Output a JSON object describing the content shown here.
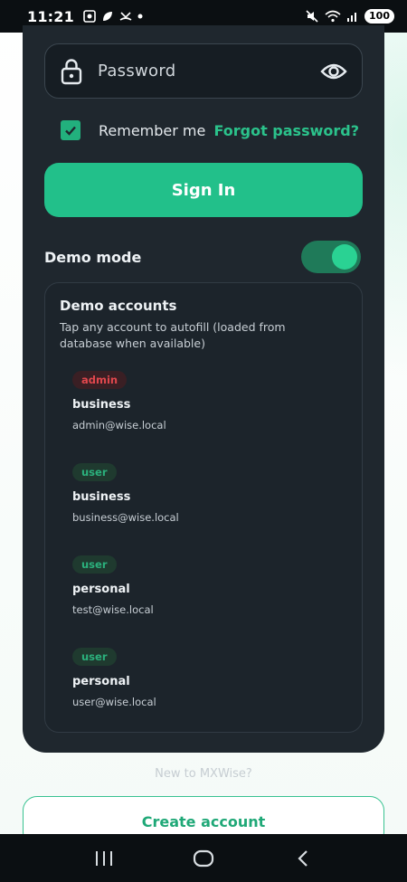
{
  "status_bar": {
    "time": "11:21",
    "battery": "100"
  },
  "login": {
    "password_placeholder": "Password",
    "remember_label": "Remember me",
    "forgot_label": "Forgot password?",
    "sign_in_label": "Sign In"
  },
  "demo": {
    "mode_label": "Demo mode",
    "enabled": true,
    "title": "Demo accounts",
    "subtitle": "Tap any account to autofill (loaded from database when available)",
    "accounts": [
      {
        "role": "admin",
        "type": "business",
        "email": "admin@wise.local"
      },
      {
        "role": "user",
        "type": "business",
        "email": "business@wise.local"
      },
      {
        "role": "user",
        "type": "personal",
        "email": "test@wise.local"
      },
      {
        "role": "user",
        "type": "personal",
        "email": "user@wise.local"
      }
    ]
  },
  "footer": {
    "new_to": "New to MXWise?",
    "create_account": "Create account"
  },
  "colors": {
    "accent": "#22c08a",
    "card_bg": "#1f272e",
    "admin_badge": "#e0474d",
    "user_badge": "#2bb07c"
  }
}
